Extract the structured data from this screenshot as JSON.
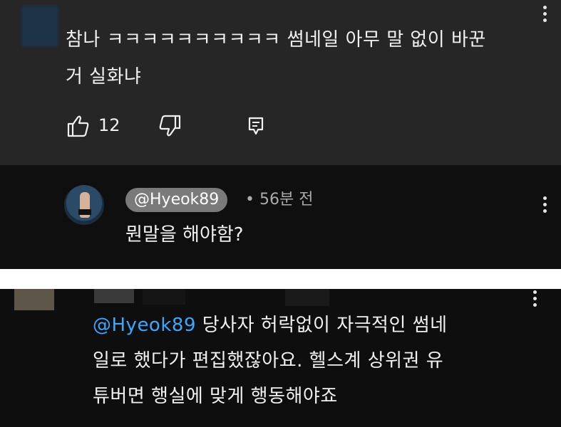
{
  "comment1": {
    "text_line1": "참나 ㅋㅋㅋㅋㅋㅋㅋㅋㅋㅋ 썸네일 아무 말 없이 바꾼",
    "text_line2": "거 실화냐",
    "like_count": "12"
  },
  "reply": {
    "handle": "@Hyeok89",
    "separator": "•",
    "time": "56분 전",
    "text": "뭔말을 해야함?"
  },
  "comment3": {
    "mention": "@Hyeok89",
    "text_after_mention": " 당사자 허락없이 자극적인 썸네",
    "text_line2": "일로 했다가 편집했잖아요. 헬스계 상위권 유",
    "text_line3": "튜버면 행실에 맞게 행동해야죠"
  },
  "icons": {
    "like": "thumb-up-icon",
    "dislike": "thumb-down-icon",
    "reply": "reply-icon",
    "menu": "more-vert-icon"
  },
  "colors": {
    "background_top": "#262626",
    "background_dark": "#0f0f0f",
    "text": "#f1f1f1",
    "mention": "#3ea6ff",
    "badge": "#7a7a7a"
  }
}
